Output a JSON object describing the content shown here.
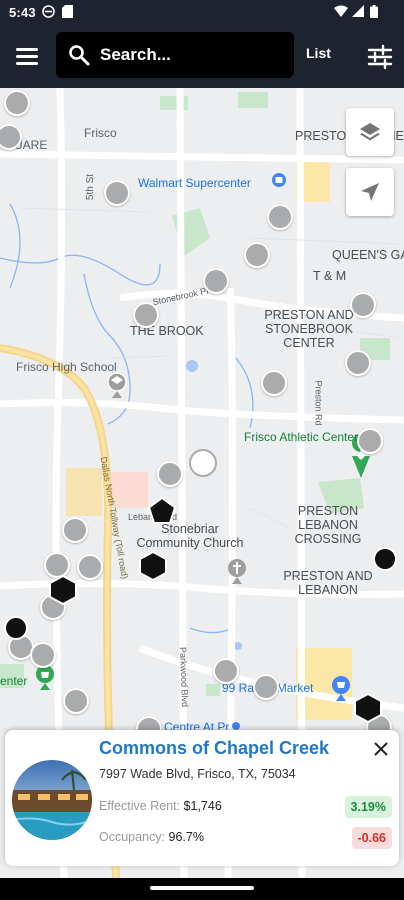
{
  "status_bar": {
    "time": "5:43"
  },
  "app_bar": {
    "search_placeholder": "Search...",
    "list_label": "List"
  },
  "map": {
    "labels": {
      "frisco": "Frisco",
      "quare": "UARE",
      "fifth_st": "5th St",
      "preston_corner": "PRESTON CORNER",
      "walmart": "Walmart Supercenter",
      "queens_gate": "QUEEN'S GATE",
      "t_and_m": "T & M",
      "stonebrook_pkwy": "Stonebrook Pkwy",
      "the_brook": "THE BROOK",
      "preston_stonebrook": "PRESTON AND STONEBROOK CENTER",
      "frisco_high": "Frisco High School",
      "preston_rd": "Preston Rd",
      "dallas_tollway": "Dallas North Tollway (Toll road)",
      "frisco_athletic": "Frisco Athletic Center",
      "lebanon_rd": "Lebanon Rd",
      "stonebriar_church": "Stonebriar Community Church",
      "preston_lebanon_crossing": "PRESTON LEBANON CROSSING",
      "preston_and_lebanon": "PRESTON AND LEBANON",
      "parkwood": "Parkwood Blvd",
      "ranch_99": "99 Ranch Market",
      "center_left": "enter",
      "centre": "ce Centre At Pr"
    }
  },
  "card": {
    "title": "Commons of Chapel Creek",
    "address": "7997 Wade Blvd, Frisco, TX, 75034",
    "effective_rent_label": "Effective Rent:",
    "effective_rent_value": "$1,746",
    "effective_rent_change": "3.19%",
    "occupancy_label": "Occupancy:",
    "occupancy_value": "96.7%",
    "occupancy_change": "-0.66"
  },
  "colors": {
    "app_bar": "#1e2330",
    "title_blue": "#1f78c8",
    "positive": "#1e8e3e",
    "negative": "#d93025"
  },
  "icons": [
    "menu-icon",
    "search-icon",
    "filter-sliders-icon",
    "layers-icon",
    "location-arrow-icon",
    "close-icon"
  ]
}
